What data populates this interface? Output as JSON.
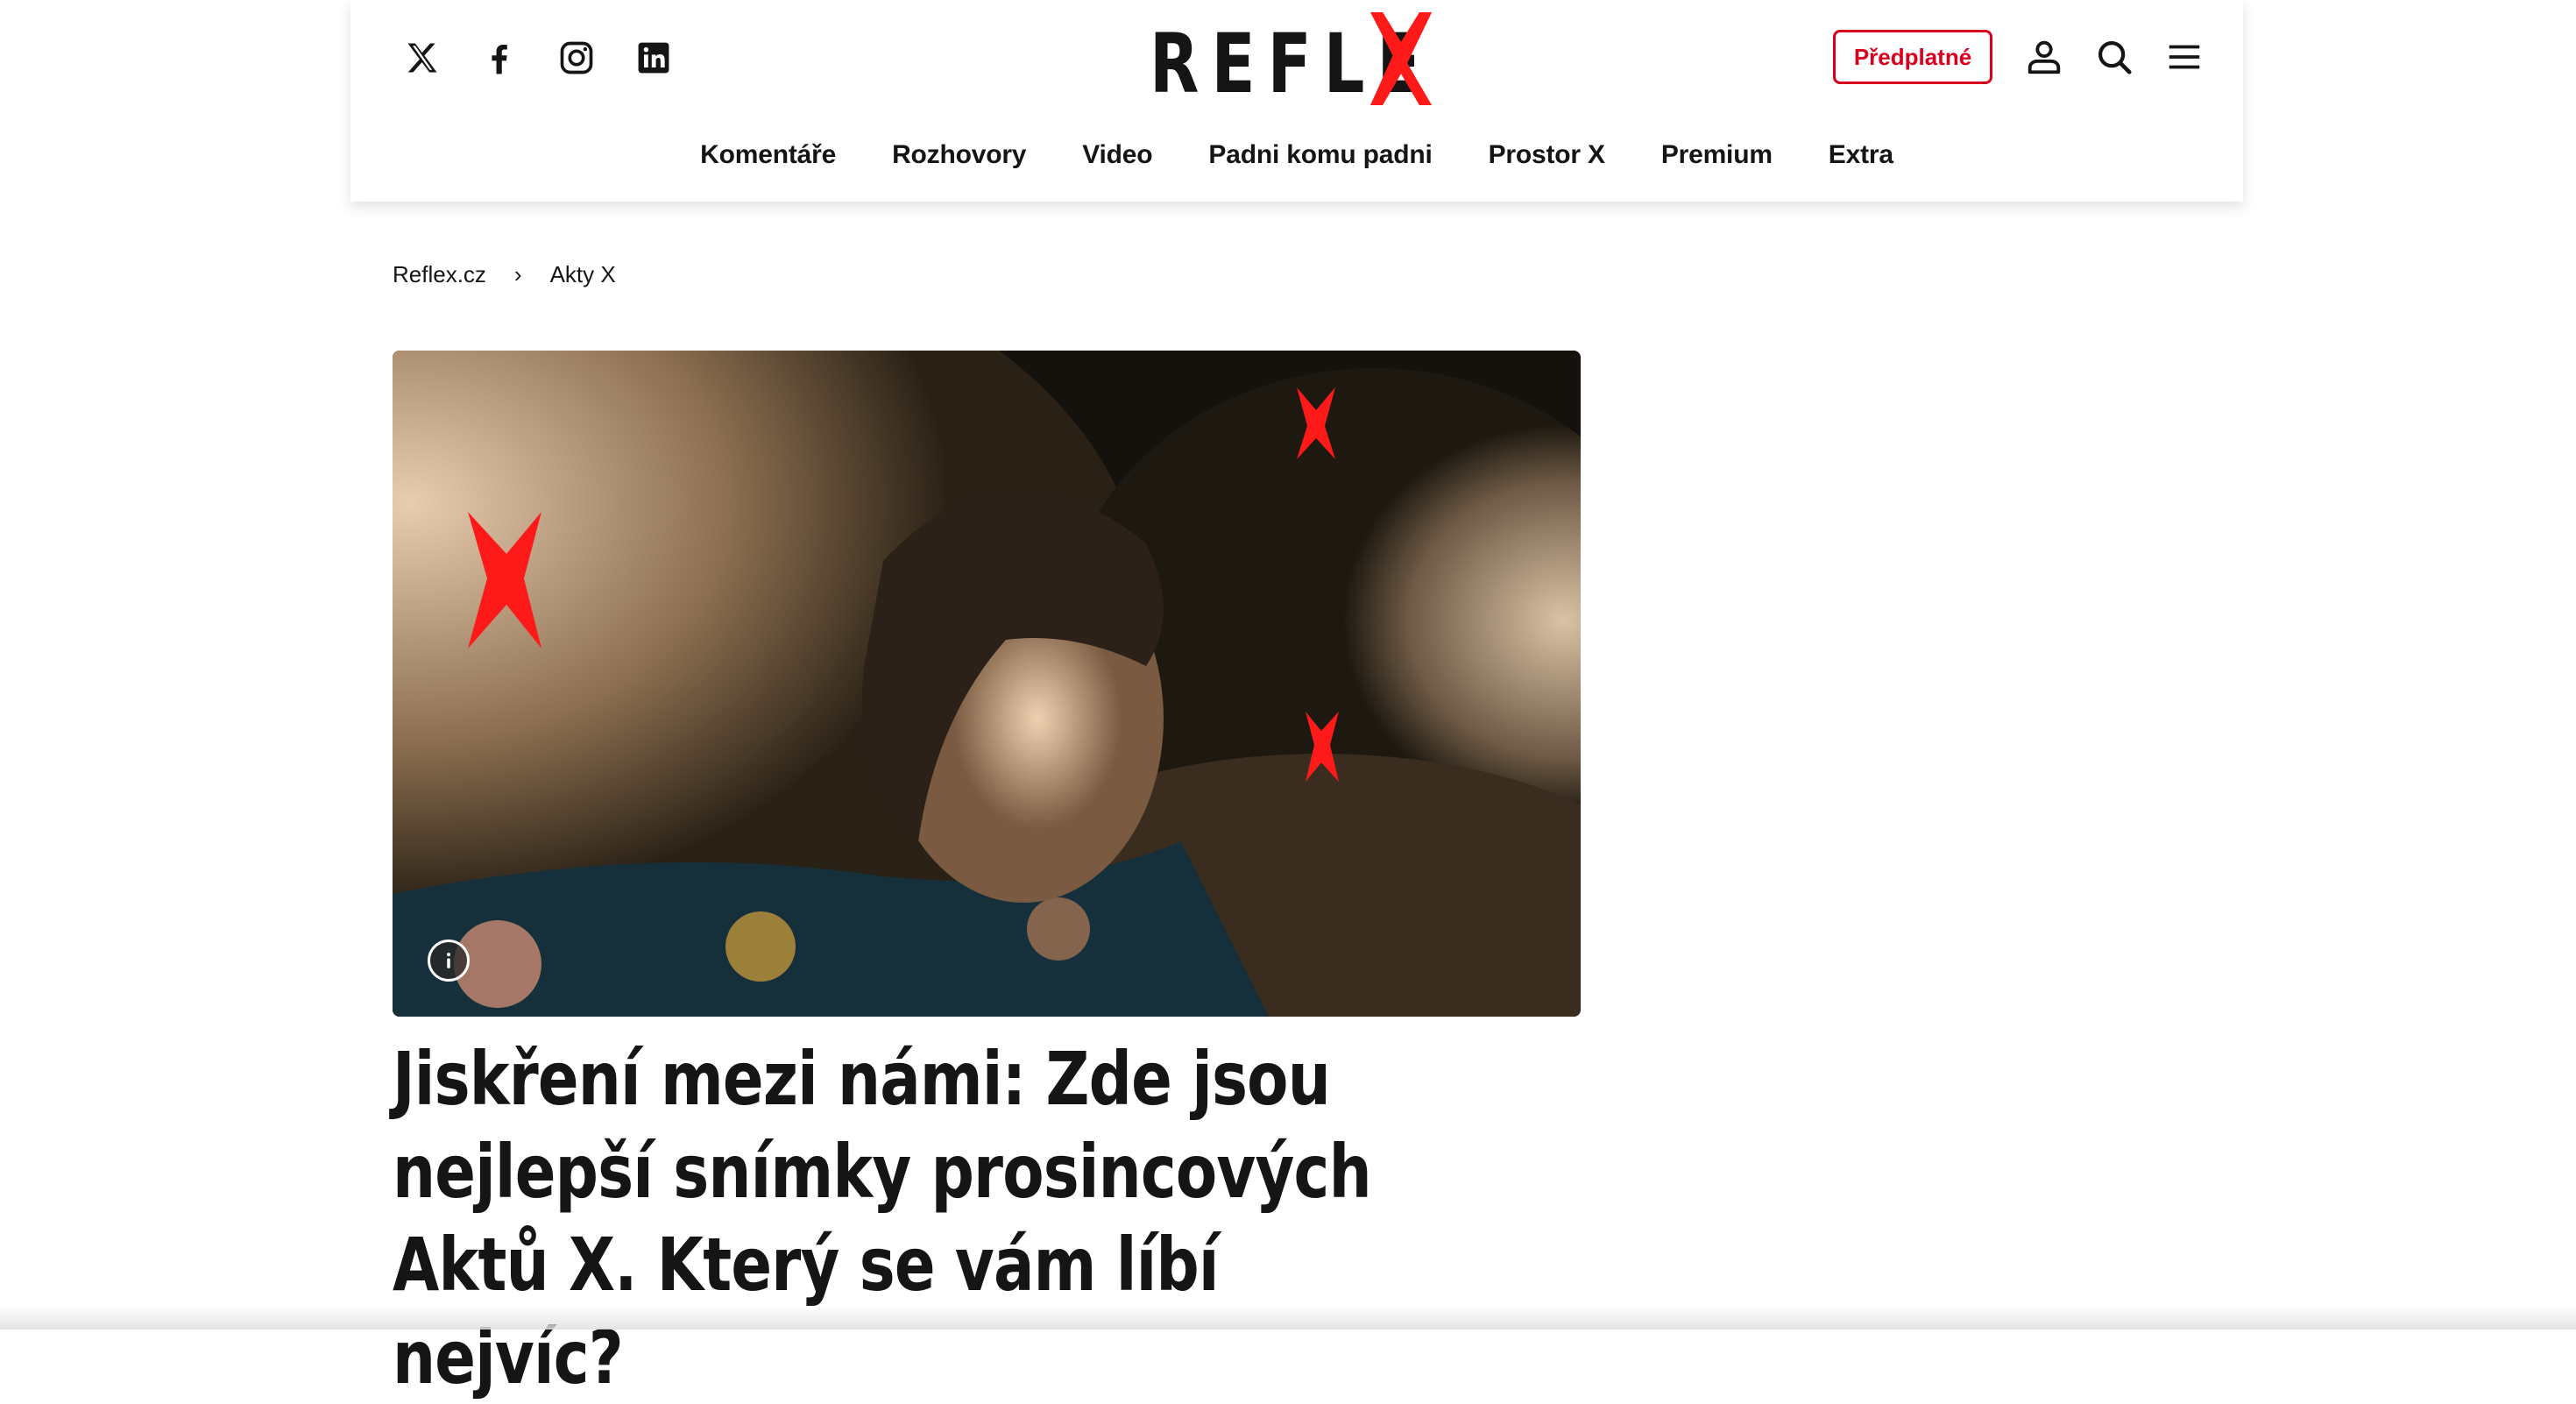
{
  "header": {
    "social": [
      {
        "icon": "x-twitter-icon",
        "label": "X"
      },
      {
        "icon": "facebook-icon",
        "label": "Facebook"
      },
      {
        "icon": "instagram-icon",
        "label": "Instagram"
      },
      {
        "icon": "linkedin-icon",
        "label": "LinkedIn"
      }
    ],
    "logo_text": "REFLE",
    "subscribe_label": "Předplatné",
    "icons": [
      "user-icon",
      "search-icon",
      "menu-icon"
    ],
    "brand_color": "#d8001d"
  },
  "nav": {
    "items": [
      "Komentáře",
      "Rozhovory",
      "Video",
      "Padni komu padni",
      "Prostor X",
      "Premium",
      "Extra"
    ]
  },
  "breadcrumb": {
    "items": [
      "Reflex.cz",
      "Akty X"
    ],
    "separator": "›"
  },
  "article": {
    "title": "Jiskření mezi námi: Zde jsou nejlepší snímky prosincových Aktů X. Který se vám líbí nejvíc?",
    "image_info_icon": "info-icon"
  }
}
